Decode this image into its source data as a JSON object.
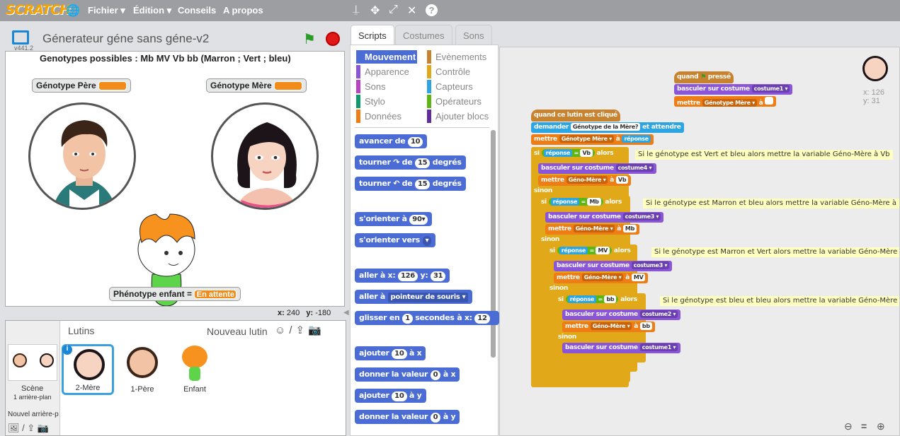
{
  "topbar": {
    "logo": "SCRATCH",
    "menus": [
      "Fichier ▾",
      "Édition ▾",
      "Conseils",
      "A propos"
    ]
  },
  "stage": {
    "title": "Génerateur géne sans géne-v2",
    "version": "v441.2",
    "genotypes_text": "Genotypes possibles : Mb MV Vb bb (Marron ; Vert ; bleu)",
    "monitor_father": "Génotype Père",
    "monitor_mother": "Génotype Mère",
    "monitor_child": "Phénotype enfant =",
    "monitor_child_value": "En attente",
    "x_label": "x:",
    "x_value": "240",
    "y_label": "y:",
    "y_value": "-180"
  },
  "sprites": {
    "header": "Lutins",
    "new_sprite": "Nouveau lutin",
    "scene_label": "Scène",
    "scene_sub": "1 arrière-plan",
    "new_backdrop": "Nouvel arrière-p",
    "items": [
      {
        "name": "2-Mère"
      },
      {
        "name": "1-Père"
      },
      {
        "name": "Enfant"
      }
    ]
  },
  "tabs": {
    "scripts": "Scripts",
    "costumes": "Costumes",
    "sounds": "Sons"
  },
  "categories": {
    "mouvement": "Mouvement",
    "apparence": "Apparence",
    "sons": "Sons",
    "stylo": "Stylo",
    "donnees": "Données",
    "evenements": "Evènements",
    "controle": "Contrôle",
    "capteurs": "Capteurs",
    "operateurs": "Opérateurs",
    "ajouter": "Ajouter blocs"
  },
  "palette": {
    "b1": "avancer de",
    "b1v": "10",
    "b2": "tourner ↷ de",
    "b2v": "15",
    "deg": "degrés",
    "b3": "tourner ↶ de",
    "b3v": "15",
    "b4": "s'orienter à",
    "b4v": "90▾",
    "b5": "s'orienter vers",
    "b5v": "▾",
    "b6a": "aller à x:",
    "b6v1": "126",
    "b6b": "y:",
    "b6v2": "31",
    "b7": "aller à",
    "b7v": "pointeur de souris ▾",
    "b8a": "glisser en",
    "b8v": "1",
    "b8b": "secondes à x:",
    "b8v2": "12",
    "b9a": "ajouter",
    "b9v": "10",
    "b9b": "à x",
    "b10a": "donner la valeur",
    "b10v": "0",
    "b10b": "à x",
    "b11a": "ajouter",
    "b11v": "10",
    "b11b": "à y",
    "b12a": "donner la valeur",
    "b12v": "0",
    "b12b": "à y"
  },
  "scripts": {
    "sprite_x": "x: 126",
    "sprite_y": "y: 31",
    "flag_hat": "quand",
    "flag_hat2": "pressé",
    "switch1": "basculer sur costume",
    "switch1v": "costume1 ▾",
    "set1": "mettre",
    "set1v": "Génotype Mère ▾",
    "set1a": "à",
    "clicked": "quand ce lutin est cliqué",
    "ask": "demander",
    "askv": "Génotype de la Mère?",
    "askw": "et attendre",
    "set2": "mettre",
    "set2v": "Génotype Mère ▾",
    "set2a": "à",
    "set2r": "réponse",
    "si": "si",
    "alors": "alors",
    "sinon": "sinon",
    "rep": "réponse",
    "eq": "=",
    "v1": "Vb",
    "v2": "Mb",
    "v3": "MV",
    "v4": "bb",
    "c4": "costume4 ▾",
    "c3": "costume3 ▾",
    "c2": "costume2 ▾",
    "c1": "costume1 ▾",
    "bas": "basculer sur costume",
    "mettre": "mettre",
    "gm": "Géno-Mère ▾",
    "a": "à",
    "n1": "Si le génotype est Vert et bleu alors mettre la variable Géno-Mère à Vb",
    "n2": "Si le génotype est Marron et bleu alors mettre la variable Géno-Mère à Mb",
    "n3": "Si le génotype est Marron et Vert alors mettre la variable Géno-Mère à MV",
    "n4": "Si le génotype est bleu et bleu alors mettre la variable Géno-Mère à bb"
  }
}
